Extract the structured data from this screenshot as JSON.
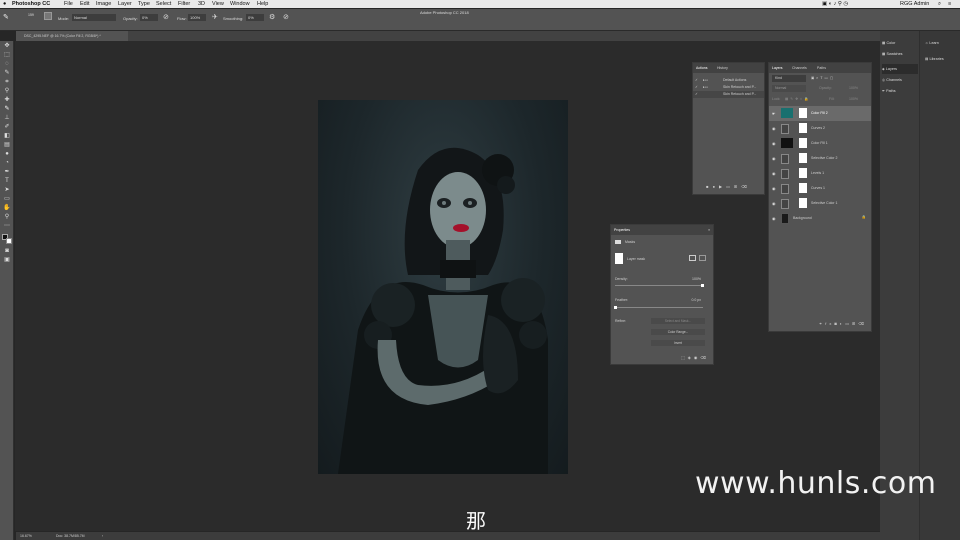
{
  "menubar": {
    "apple": "",
    "app_name": "Photoshop CC",
    "items": [
      "File",
      "Edit",
      "Image",
      "Layer",
      "Type",
      "Select",
      "Filter",
      "3D",
      "View",
      "Window",
      "Help"
    ],
    "right_user": "RGG Admin"
  },
  "window": {
    "title": "Adobe Photoshop CC 2018"
  },
  "options_bar": {
    "mode_label": "Mode:",
    "mode_value": "Normal",
    "opacity_label": "Opacity:",
    "opacity_value": "0%",
    "flow_label": "Flow:",
    "flow_value": "100%",
    "smoothing_label": "Smoothing:",
    "smoothing_value": "0%",
    "brush_size": "159"
  },
  "document_tab": {
    "label": "DSC_4295.NEF @ 16.7% (Color Fill 2, RGB/8*) *"
  },
  "status_bar": {
    "zoom": "16.67%",
    "doc": "Doc: 38.7M/85.7M"
  },
  "actions_panel": {
    "tabs": [
      "Actions",
      "History"
    ],
    "items": [
      "Default Actions",
      "Skin Retouch and P...",
      "Skin Retouch and P..."
    ]
  },
  "properties_panel": {
    "title": "Properties",
    "section": "Masks",
    "mask_label": "Layer mask",
    "density_label": "Density:",
    "density_value": "100%",
    "feather_label": "Feather:",
    "feather_value": "0.0 px",
    "refine_label": "Refine:",
    "select_mask_button": "Select and Mask...",
    "color_range_button": "Color Range...",
    "invert_button": "Invert"
  },
  "layers_panel": {
    "tabs": [
      "Layers",
      "Channels",
      "Paths"
    ],
    "kind_label": "Kind",
    "blend_mode": "Normal",
    "opacity_label": "Opacity:",
    "opacity_value": "100%",
    "lock_label": "Lock:",
    "fill_label": "Fill:",
    "fill_value": "100%",
    "layers": [
      {
        "name": "Color Fill 2",
        "selected": true,
        "thumb": "#19706f"
      },
      {
        "name": "Curves 2",
        "selected": false,
        "thumb": "#444"
      },
      {
        "name": "Color Fill 1",
        "selected": false,
        "thumb": "#111"
      },
      {
        "name": "Selective Color 2",
        "selected": false,
        "thumb": "#444"
      },
      {
        "name": "Levels 1",
        "selected": false,
        "thumb": "#444"
      },
      {
        "name": "Curves 1",
        "selected": false,
        "thumb": "#444"
      },
      {
        "name": "Selective Color 1",
        "selected": false,
        "thumb": "#444"
      },
      {
        "name": "Background",
        "selected": false,
        "thumb": "#1a1a1a"
      }
    ]
  },
  "dock": {
    "left_items": [
      "Color",
      "Swatches",
      "Layers",
      "Channels",
      "Paths"
    ],
    "right_items": [
      "Learn",
      "Libraries"
    ]
  },
  "overlay": {
    "watermark": "www.hunls.com",
    "subtitle": "那"
  }
}
